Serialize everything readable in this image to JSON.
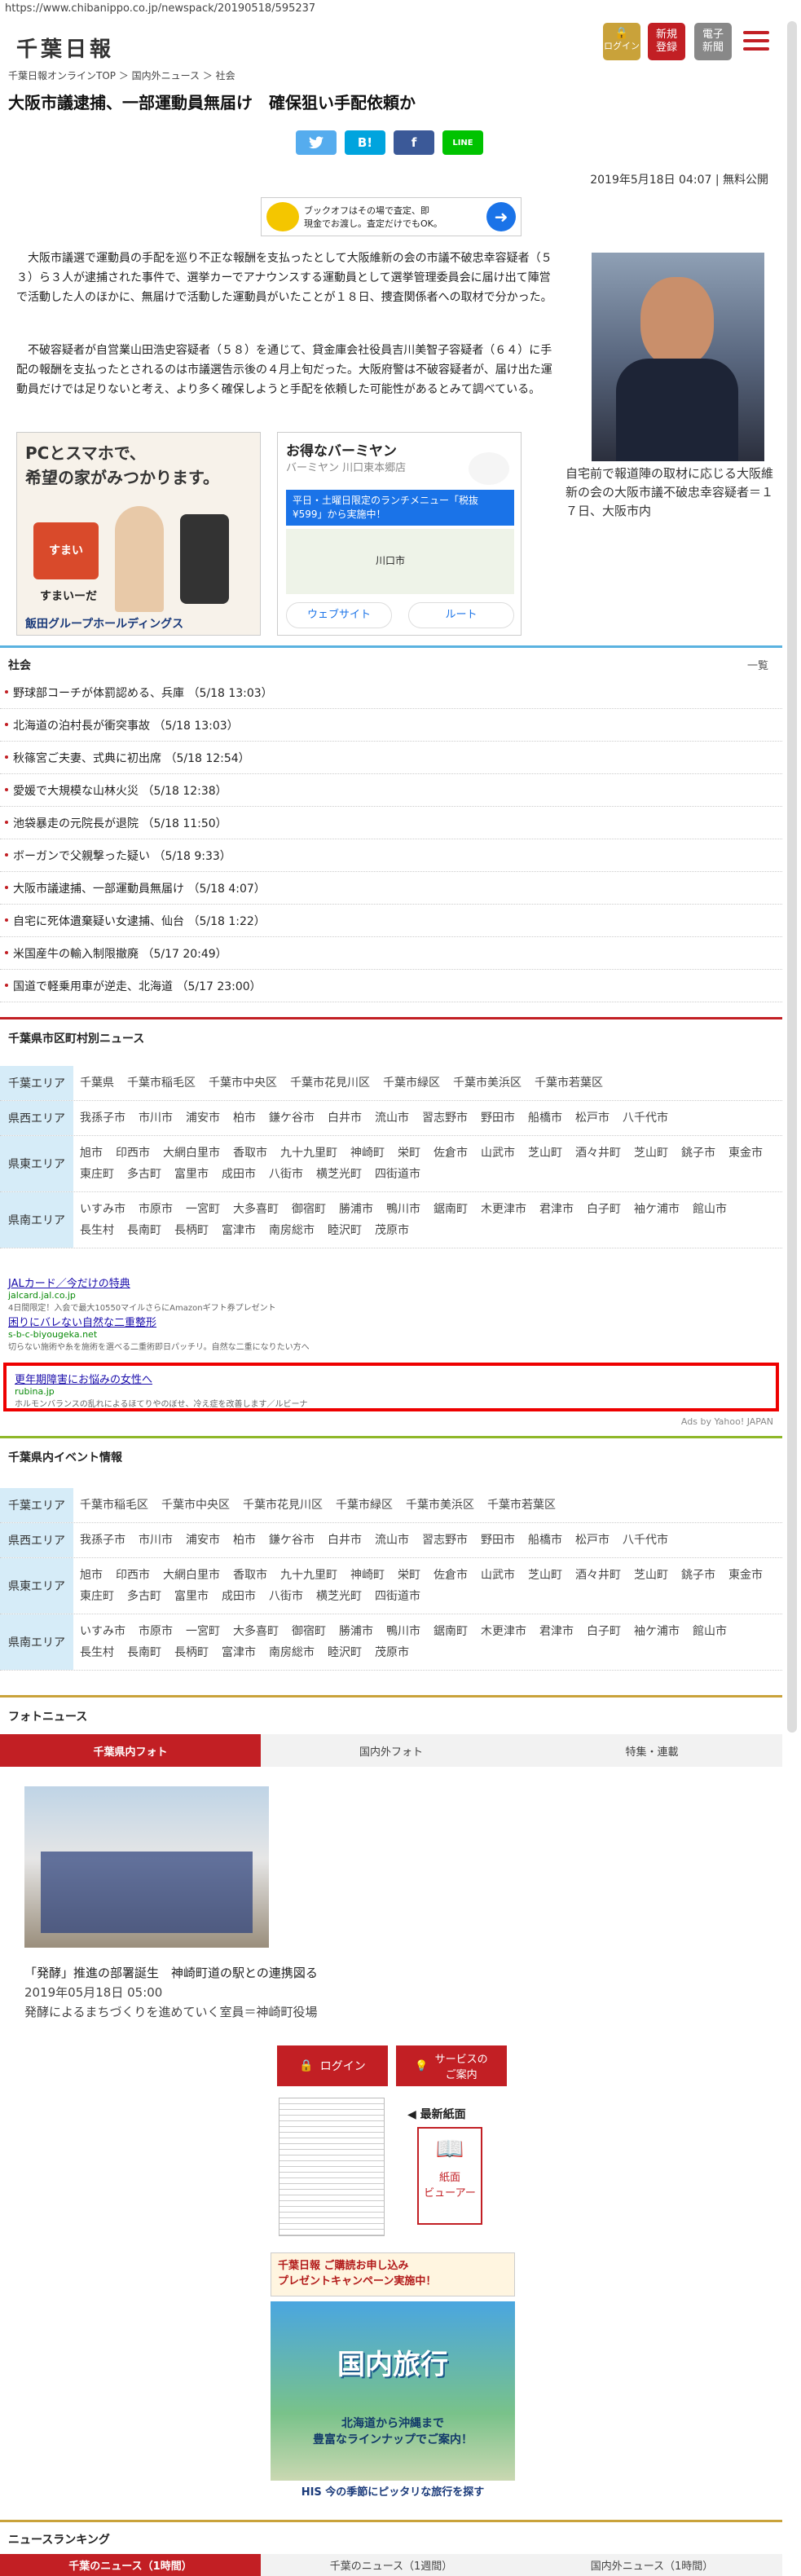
{
  "url": "https://www.chibanippo.co.jp/newspack/20190518/595237",
  "header": {
    "logo": "千葉日報",
    "login": "ログイン",
    "register": "新規\n登録",
    "epaper": "電子\n新聞"
  },
  "breadcrumb": "千葉日報オンラインTOP ＞ 国内外ニュース ＞ 社会",
  "article": {
    "title": "大阪市議逮捕、一部運動員無届け　確保狙い手配依頼か",
    "date": "2019年5月18日 04:07 | 無料公開",
    "para1": "　大阪市議選で運動員の手配を巡り不正な報酬を支払ったとして大阪維新の会の市議不破忠幸容疑者（５３）ら３人が逮捕された事件で、選挙カーでアナウンスする運動員として選挙管理委員会に届け出て陣営で活動した人のほかに、無届けで活動した運動員がいたことが１８日、捜査関係者への取材で分かった。",
    "para2": "　不破容疑者が自営業山田浩史容疑者（５８）を通じて、貸金庫会社役員吉川美智子容疑者（６４）に手配の報酬を支払ったとされるのは市議選告示後の４月上旬だった。大阪府警は不破容疑者が、届け出た運動員だけでは足りないと考え、より多く確保しようと手配を依頼した可能性があるとみて調べている。",
    "photo_caption": "自宅前で報道陣の取材に応じる大阪維新の会の大阪市議不破忠幸容疑者＝１７日、大阪市内"
  },
  "share": {
    "twitter": "",
    "hatena": "B!",
    "facebook": "f",
    "line": "LINE"
  },
  "ads": {
    "top_ad": "ブックオフはその場で査定、即\n現金でお渡し。査定だけでもOK。",
    "house_ad_title": "PCとスマホで、\n希望の家がみつかります。",
    "house_ad_brand": "すまいーだ",
    "house_ad_company": "飯田グループホールディングス",
    "map_ad_title": "お得なバーミヤン",
    "map_ad_sub": "バーミヤン 川口東本郷店",
    "map_ad_promo": "平日・土曜日限定のランチメニュー「税抜¥599」から実施中！",
    "map_ad_city": "川口市",
    "map_ad_web": "ウェブサイト",
    "map_ad_route": "ルート",
    "text_ads": [
      {
        "title": "JALカード／今だけの特典",
        "url": "jalcard.jal.co.jp",
        "desc": "4日間限定！入会で最大10550マイルさらにAmazonギフト券プレゼント"
      },
      {
        "title": "困りにバレない自然な二重整形",
        "url": "s-b-c-biyougeka.net",
        "desc": "切らない施術や糸を施術を選べる二重術即日パッチリ。自然な二重になりたい方へ"
      },
      {
        "title": "更年期障害にお悩みの女性へ",
        "url": "rubina.jp",
        "desc": "ホルモンバランスの乱れによるほてりやのぼせ、冷え症を改善します／ルビーナ"
      }
    ],
    "yahoo": "Ads by Yahoo! JAPAN"
  },
  "news": {
    "heading": "社会",
    "more": "一覧",
    "items": [
      "野球部コーチが体罰認める、兵庫 （5/18 13:03）",
      "北海道の泊村長が衝突事故 （5/18 13:03）",
      "秋篠宮ご夫妻、式典に初出席 （5/18 12:54）",
      "愛媛で大規模な山林火災 （5/18 12:38）",
      "池袋暴走の元院長が退院 （5/18 11:50）",
      "ボーガンで父親撃った疑い （5/18 9:33）",
      "大阪市議逮捕、一部運動員無届け （5/18 4:07）",
      "自宅に死体遺棄疑い女逮捕、仙台 （5/18 1:22）",
      "米国産牛の輸入制限撤廃 （5/17 20:49）",
      "国道で軽乗用車が逆走、北海道 （5/17 23:00）"
    ]
  },
  "local_news": {
    "heading": "千葉県市区町村別ニュース",
    "rows": [
      {
        "label": "千葉エリア",
        "items": [
          "千葉県",
          "千葉市稲毛区",
          "千葉市中央区",
          "千葉市花見川区",
          "千葉市緑区",
          "千葉市美浜区",
          "千葉市若葉区"
        ]
      },
      {
        "label": "県西エリア",
        "items": [
          "我孫子市",
          "市川市",
          "浦安市",
          "柏市",
          "鎌ケ谷市",
          "白井市",
          "流山市",
          "習志野市",
          "野田市",
          "船橋市",
          "松戸市",
          "八千代市"
        ]
      },
      {
        "label": "県東エリア",
        "items": [
          "旭市",
          "印西市",
          "大網白里市",
          "香取市",
          "九十九里町",
          "神崎町",
          "栄町",
          "佐倉市",
          "山武市",
          "芝山町",
          "酒々井町",
          "芝山町",
          "銚子市",
          "東金市",
          "東庄町",
          "多古町",
          "富里市",
          "成田市",
          "八街市",
          "横芝光町",
          "四街道市"
        ]
      },
      {
        "label": "県南エリア",
        "items": [
          "いすみ市",
          "市原市",
          "一宮町",
          "大多喜町",
          "御宿町",
          "勝浦市",
          "鴨川市",
          "鋸南町",
          "木更津市",
          "君津市",
          "白子町",
          "袖ケ浦市",
          "館山市",
          "長生村",
          "長南町",
          "長柄町",
          "富津市",
          "南房総市",
          "睦沢町",
          "茂原市"
        ]
      }
    ]
  },
  "events": {
    "heading": "千葉県内イベント情報",
    "rows": [
      {
        "label": "千葉エリア",
        "items": [
          "千葉市稲毛区",
          "千葉市中央区",
          "千葉市花見川区",
          "千葉市緑区",
          "千葉市美浜区",
          "千葉市若葉区"
        ]
      },
      {
        "label": "県西エリア",
        "items": [
          "我孫子市",
          "市川市",
          "浦安市",
          "柏市",
          "鎌ケ谷市",
          "白井市",
          "流山市",
          "習志野市",
          "野田市",
          "船橋市",
          "松戸市",
          "八千代市"
        ]
      },
      {
        "label": "県東エリア",
        "items": [
          "旭市",
          "印西市",
          "大網白里市",
          "香取市",
          "九十九里町",
          "神崎町",
          "栄町",
          "佐倉市",
          "山武市",
          "芝山町",
          "酒々井町",
          "芝山町",
          "銚子市",
          "東金市",
          "東庄町",
          "多古町",
          "富里市",
          "成田市",
          "八街市",
          "横芝光町",
          "四街道市"
        ]
      },
      {
        "label": "県南エリア",
        "items": [
          "いすみ市",
          "市原市",
          "一宮町",
          "大多喜町",
          "御宿町",
          "勝浦市",
          "鴨川市",
          "鋸南町",
          "木更津市",
          "君津市",
          "白子町",
          "袖ケ浦市",
          "館山市",
          "長生村",
          "長南町",
          "長柄町",
          "富津市",
          "南房総市",
          "睦沢町",
          "茂原市"
        ]
      }
    ]
  },
  "photo_news": {
    "heading": "フォトニュース",
    "tabs": [
      "千葉県内フォト",
      "国内外フォト",
      "特集・連載"
    ],
    "title": "「発酵」推進の部署誕生　神崎町道の駅との連携図る",
    "date": "2019年05月18日 05:00",
    "caption": "発酵によるまちづくりを進めていく室員＝神崎町役場"
  },
  "service": {
    "login": "ログイン",
    "guide": "サービスの\nご案内",
    "latest": "◀ 最新紙面",
    "viewer": "紙面\nビューアー",
    "banner1": "千葉日報 ご購読お申し込み\nプレゼントキャンペーン実施中！",
    "banner2_title": "国内旅行",
    "banner2_sub": "北海道から沖縄まで\n豊富なラインナップでご案内！",
    "banner2_foot": "HIS 今の季節にピッタリな旅行を探す"
  },
  "ranking": {
    "heading": "ニュースランキング",
    "tabs": [
      "千葉のニュース（1時間）",
      "千葉のニュース（1週間）",
      "国内外ニュース（1時間）"
    ]
  },
  "colors": {
    "brand_red": "#c21f24",
    "area_bg": "#d6ecf8"
  }
}
